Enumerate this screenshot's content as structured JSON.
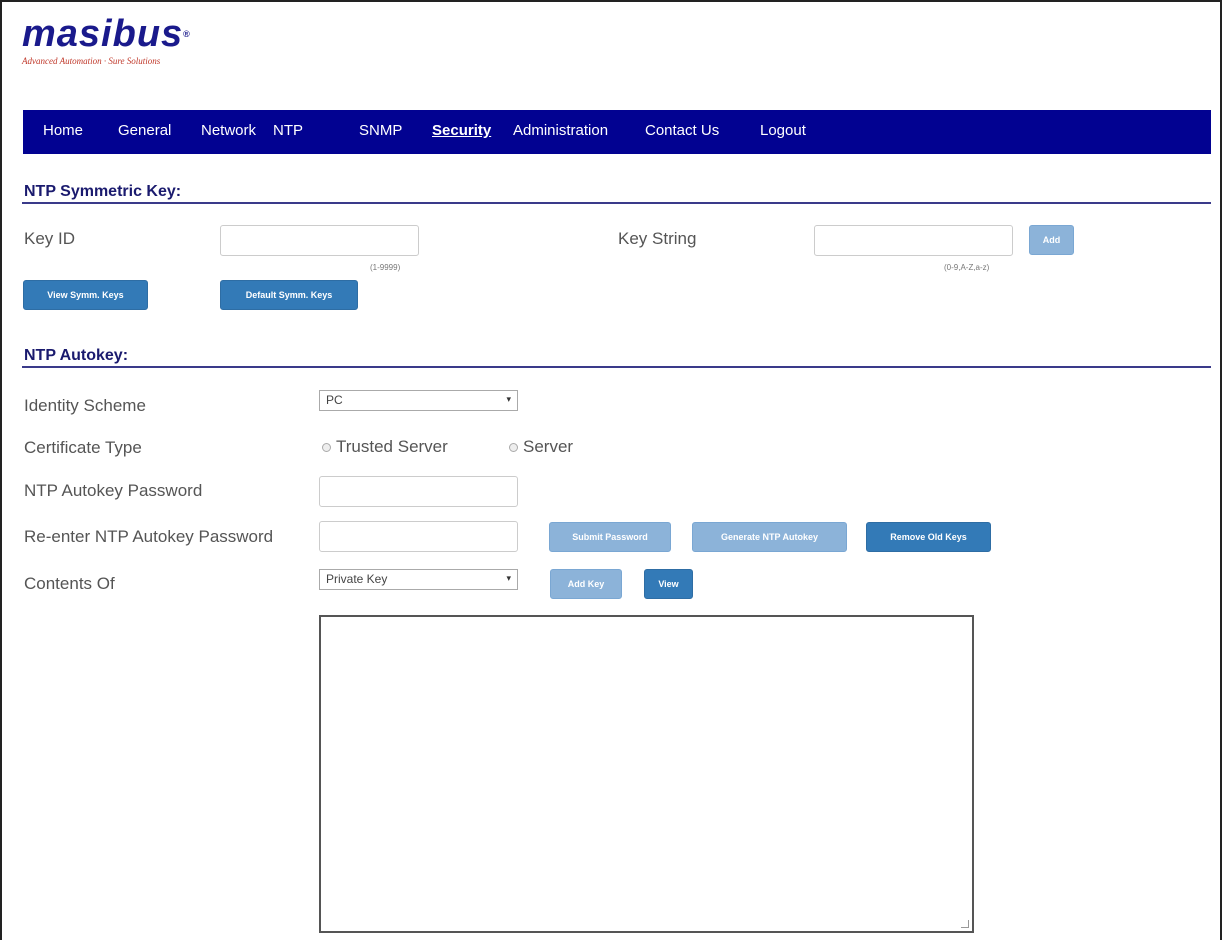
{
  "brand": {
    "name": "masibus",
    "reg": "®",
    "tagline": "Advanced Automation · Sure Solutions"
  },
  "nav": {
    "items": [
      "Home",
      "General",
      "Network",
      "NTP",
      "SNMP",
      "Security",
      "Administration",
      "Contact Us",
      "Logout"
    ],
    "active": "Security"
  },
  "symmetric": {
    "title": "NTP Symmetric Key:",
    "key_id_label": "Key ID",
    "key_id_value": "",
    "key_id_hint": "(1-9999)",
    "key_string_label": "Key String",
    "key_string_value": "",
    "key_string_hint": "(0-9,A-Z,a-z)",
    "add_button": "Add",
    "view_button": "View Symm. Keys",
    "default_button": "Default Symm. Keys"
  },
  "autokey": {
    "title": "NTP Autokey:",
    "identity_label": "Identity Scheme",
    "identity_value": "PC",
    "cert_label": "Certificate Type",
    "cert_options": [
      "Trusted Server",
      "Server"
    ],
    "password_label": "NTP Autokey Password",
    "password_value": "",
    "reenter_label": "Re-enter NTP Autokey Password",
    "reenter_value": "",
    "submit_button": "Submit Password",
    "generate_button": "Generate NTP Autokey",
    "remove_button": "Remove Old Keys",
    "contents_label": "Contents Of",
    "contents_value": "Private Key",
    "addkey_button": "Add Key",
    "view_button": "View",
    "contents_text": ""
  },
  "colors": {
    "navbar": "#020291",
    "button_primary": "#337ab7",
    "button_disabled": "#8cb3d9",
    "brand": "#1a1a8c",
    "tagline": "#c0392b"
  }
}
